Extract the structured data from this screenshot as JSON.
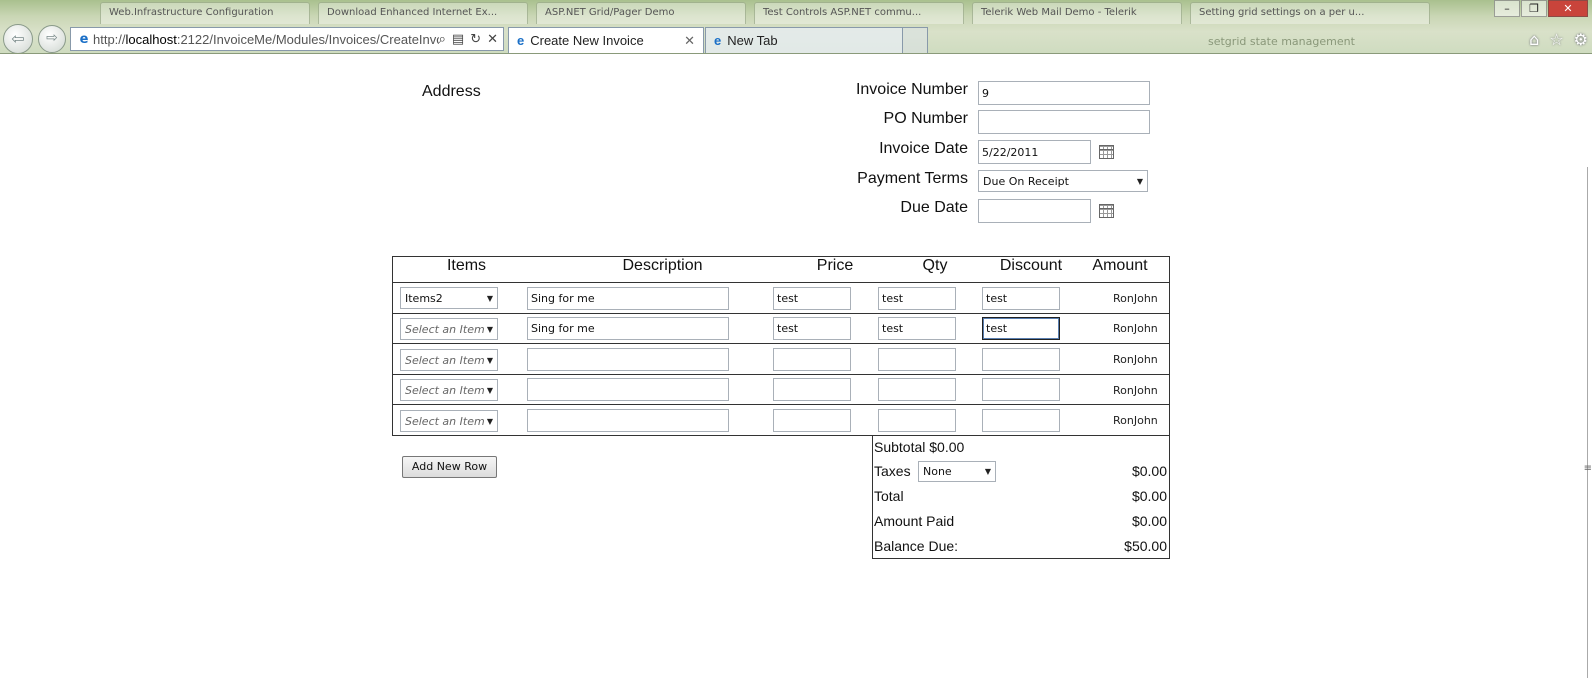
{
  "browser": {
    "background_tabs": [
      "Web.Infrastructure Configuration",
      "Download Enhanced Internet Ex...",
      "ASP.NET Grid/Pager Demo",
      "Test Controls ASP.NET commu...",
      "Telerik Web Mail Demo - Telerik",
      "Setting grid settings on a per u..."
    ],
    "url_prefix": "http://",
    "url_host": "localhost",
    "url_rest": ":2122/InvoiceMe/Modules/Invoices/CreateInvo",
    "active_tab": "Create New Invoice",
    "inactive_tab": "New Tab",
    "faint_text": "setgrid state management"
  },
  "form": {
    "address_label": "Address",
    "invoice_number_label": "Invoice Number",
    "invoice_number_value": "9",
    "po_number_label": "PO Number",
    "po_number_value": "",
    "invoice_date_label": "Invoice Date",
    "invoice_date_value": "5/22/2011",
    "payment_terms_label": "Payment Terms",
    "payment_terms_value": "Due On Receipt",
    "due_date_label": "Due Date",
    "due_date_value": ""
  },
  "table": {
    "headers": [
      "Items",
      "Description",
      "Price",
      "Qty",
      "Discount",
      "Amount"
    ],
    "rows": [
      {
        "item": "Items2",
        "item_placeholder": false,
        "description": "Sing for me",
        "price": "test",
        "qty": "test",
        "discount": "test",
        "amount": "RonJohn"
      },
      {
        "item": "Select an Item",
        "item_placeholder": true,
        "description": "Sing for me",
        "price": "test",
        "qty": "test",
        "discount": "test",
        "amount": "RonJohn"
      },
      {
        "item": "Select an Item",
        "item_placeholder": true,
        "description": "",
        "price": "",
        "qty": "",
        "discount": "",
        "amount": "RonJohn"
      },
      {
        "item": "Select an Item",
        "item_placeholder": true,
        "description": "",
        "price": "",
        "qty": "",
        "discount": "",
        "amount": "RonJohn"
      },
      {
        "item": "Select an Item",
        "item_placeholder": true,
        "description": "",
        "price": "",
        "qty": "",
        "discount": "",
        "amount": "RonJohn"
      }
    ]
  },
  "add_row_label": "Add New Row",
  "totals": {
    "subtotal_label": "Subtotal $0.00",
    "taxes_label": "Taxes",
    "taxes_select": "None",
    "taxes_value": "$0.00",
    "total_label": "Total",
    "total_value": "$0.00",
    "amount_paid_label": "Amount Paid",
    "amount_paid_value": "$0.00",
    "balance_due_label": "Balance Due:",
    "balance_due_value": "$50.00"
  }
}
